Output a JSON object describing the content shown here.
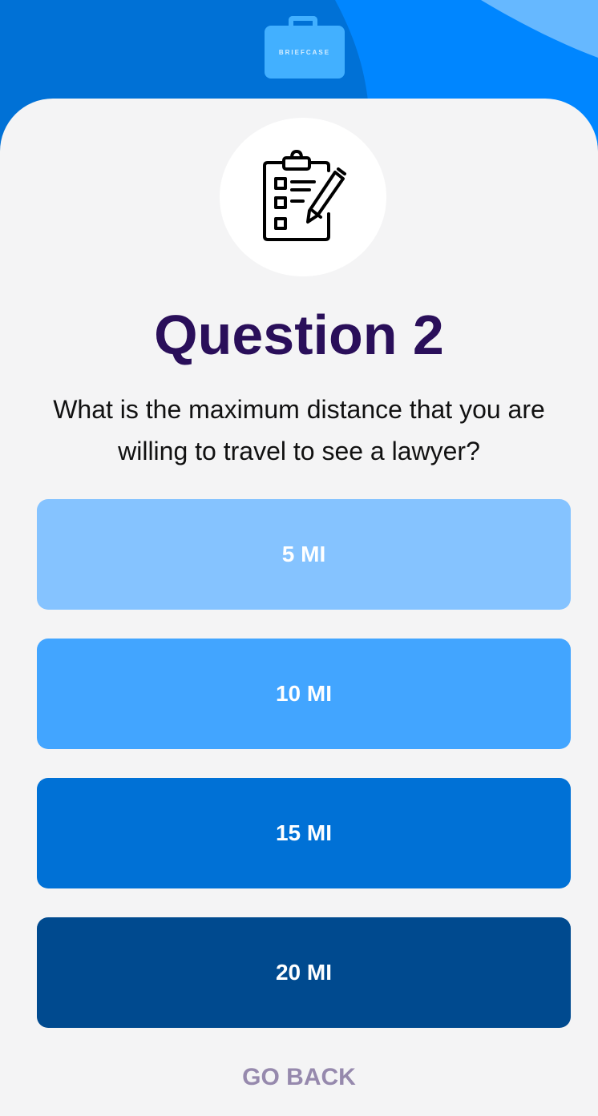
{
  "logo": {
    "text": "BRIEFCASE"
  },
  "question": {
    "title": "Question 2",
    "text": "What is the maximum distance that you are willing to travel to see a lawyer?"
  },
  "options": [
    {
      "label": "5 MI",
      "color": "#85c3ff"
    },
    {
      "label": "10 MI",
      "color": "#42a5ff"
    },
    {
      "label": "15 MI",
      "color": "#0071d6"
    },
    {
      "label": "20 MI",
      "color": "#004a8f"
    }
  ],
  "go_back_label": "GO BACK",
  "colors": {
    "header_blue": "#0071d6",
    "header_bright_blue": "#0086ff",
    "header_light_blue": "#66b8ff",
    "title_color": "#2a0f5a",
    "go_back_color": "#9689ad",
    "card_background": "#f4f4f5"
  },
  "icons": {
    "question": "clipboard-checklist-icon"
  }
}
